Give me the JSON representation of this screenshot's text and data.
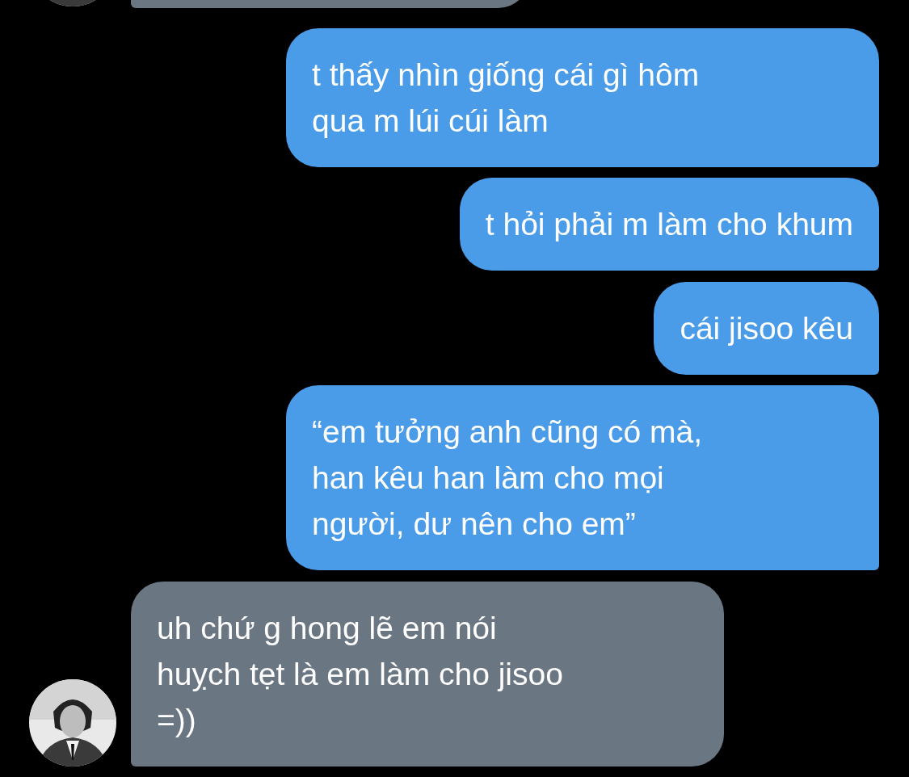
{
  "messages": [
    {
      "kind": "incoming",
      "cut_off": true
    },
    {
      "kind": "outgoing",
      "lines": [
        "t thấy nhìn giống cái gì hôm",
        "qua m lúi cúi làm"
      ]
    },
    {
      "kind": "outgoing",
      "lines": [
        "t hỏi phải m làm cho khum"
      ]
    },
    {
      "kind": "outgoing",
      "lines": [
        "cái jisoo kêu"
      ]
    },
    {
      "kind": "outgoing",
      "lines": [
        "“em tưởng anh cũng có mà,",
        "han kêu han làm cho mọi",
        "người, dư nên cho em”"
      ]
    },
    {
      "kind": "incoming",
      "lines": [
        "uh chứ g hong lẽ em nói",
        "huỵch tẹt là em làm cho jisoo",
        "=))"
      ]
    }
  ]
}
